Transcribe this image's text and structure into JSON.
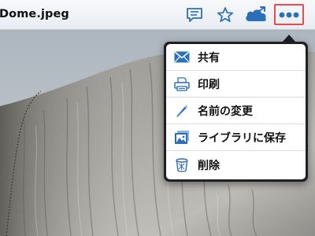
{
  "toolbar": {
    "title": "Dome.jpeg",
    "buttons": {
      "comment_icon": "comment-icon",
      "star_icon": "star-icon",
      "cloud_upload_icon": "cloud-upload-icon",
      "more_icon": "more-options-icon"
    }
  },
  "menu": {
    "items": [
      {
        "label": "共有",
        "icon": "envelope-icon"
      },
      {
        "label": "印刷",
        "icon": "printer-icon"
      },
      {
        "label": "名前の変更",
        "icon": "pencil-icon"
      },
      {
        "label": "ライブラリに保存",
        "icon": "photo-library-icon"
      },
      {
        "label": "削除",
        "icon": "trash-icon"
      }
    ]
  },
  "colors": {
    "accent": "#2a6fba",
    "highlight": "#e84b4b",
    "popover_frame": "#1d1f24"
  }
}
